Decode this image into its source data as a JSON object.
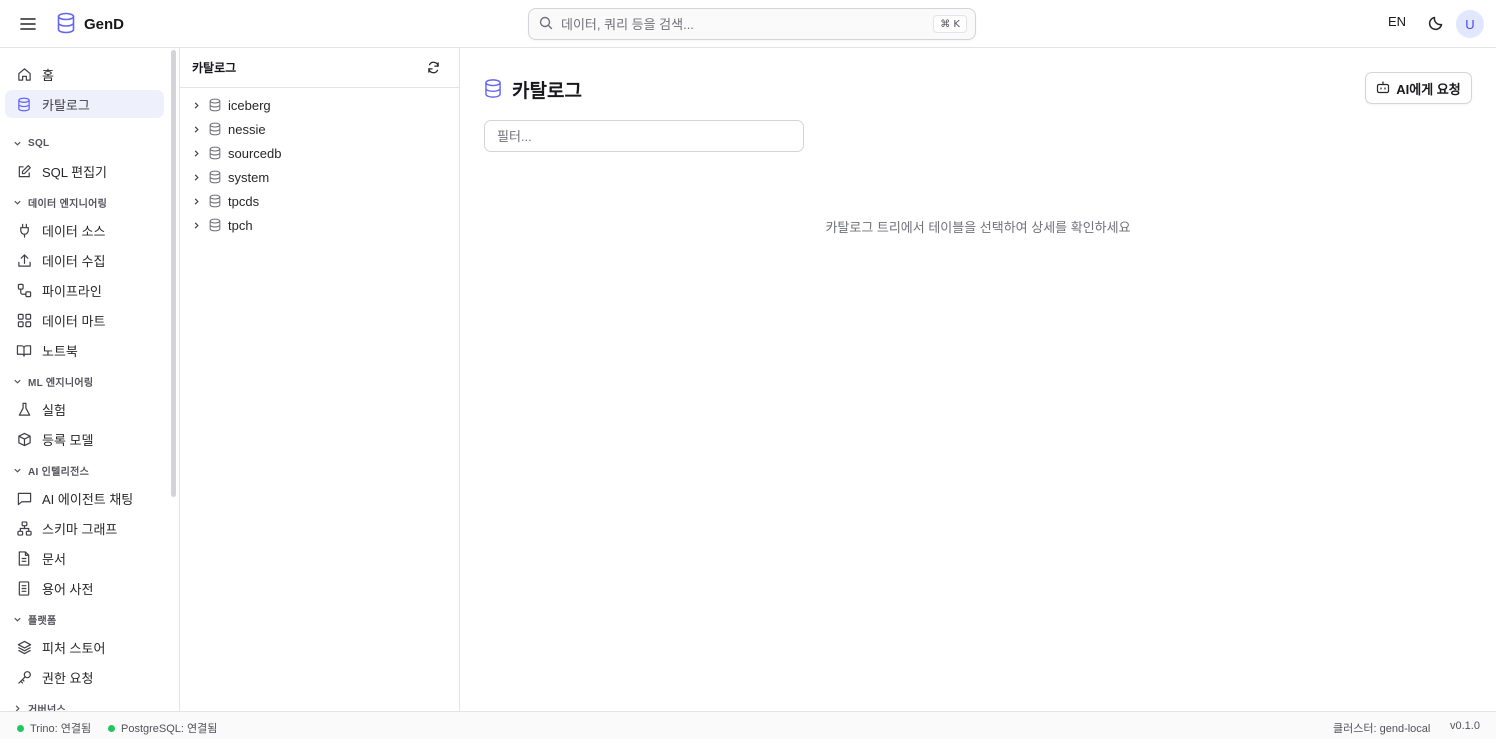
{
  "header": {
    "app_name": "GenD",
    "search_placeholder": "데이터, 쿼리 등을 검색...",
    "search_shortcut": "⌘ K",
    "language": "EN",
    "avatar_initial": "U"
  },
  "sidebar": {
    "home": "홈",
    "catalog": "카탈로그",
    "sections": {
      "sql": "SQL",
      "data_engineering": "데이터 엔지니어링",
      "ml_engineering": "ML 엔지니어링",
      "ai_intelligence": "AI 인텔리전스",
      "platform": "플랫폼",
      "governance": "거버넌스"
    },
    "items": {
      "sql_editor": "SQL 편집기",
      "data_source": "데이터 소스",
      "data_ingestion": "데이터 수집",
      "pipeline": "파이프라인",
      "data_mart": "데이터 마트",
      "notebook": "노트북",
      "experiment": "실험",
      "registered_model": "등록 모델",
      "ai_agent_chat": "AI 에이전트 채팅",
      "schema_graph": "스키마 그래프",
      "documents": "문서",
      "glossary": "용어 사전",
      "feature_store": "피처 스토어",
      "permission_request": "권한 요청"
    }
  },
  "tree": {
    "title": "카탈로그",
    "catalogs": [
      "iceberg",
      "nessie",
      "sourcedb",
      "system",
      "tpcds",
      "tpch"
    ]
  },
  "main": {
    "title": "카탈로그",
    "ai_button": "AI에게 요청",
    "filter_placeholder": "필터...",
    "empty_message": "카탈로그 트리에서 테이블을 선택하여 상세를 확인하세요"
  },
  "footer": {
    "trino_status": "Trino: 연결됨",
    "postgres_status": "PostgreSQL: 연결됨",
    "cluster": "클러스터: gend-local",
    "version": "v0.1.0"
  },
  "colors": {
    "accent": "#6366f1",
    "active_bg": "#eef0fb",
    "status_ok": "#22c55e"
  }
}
